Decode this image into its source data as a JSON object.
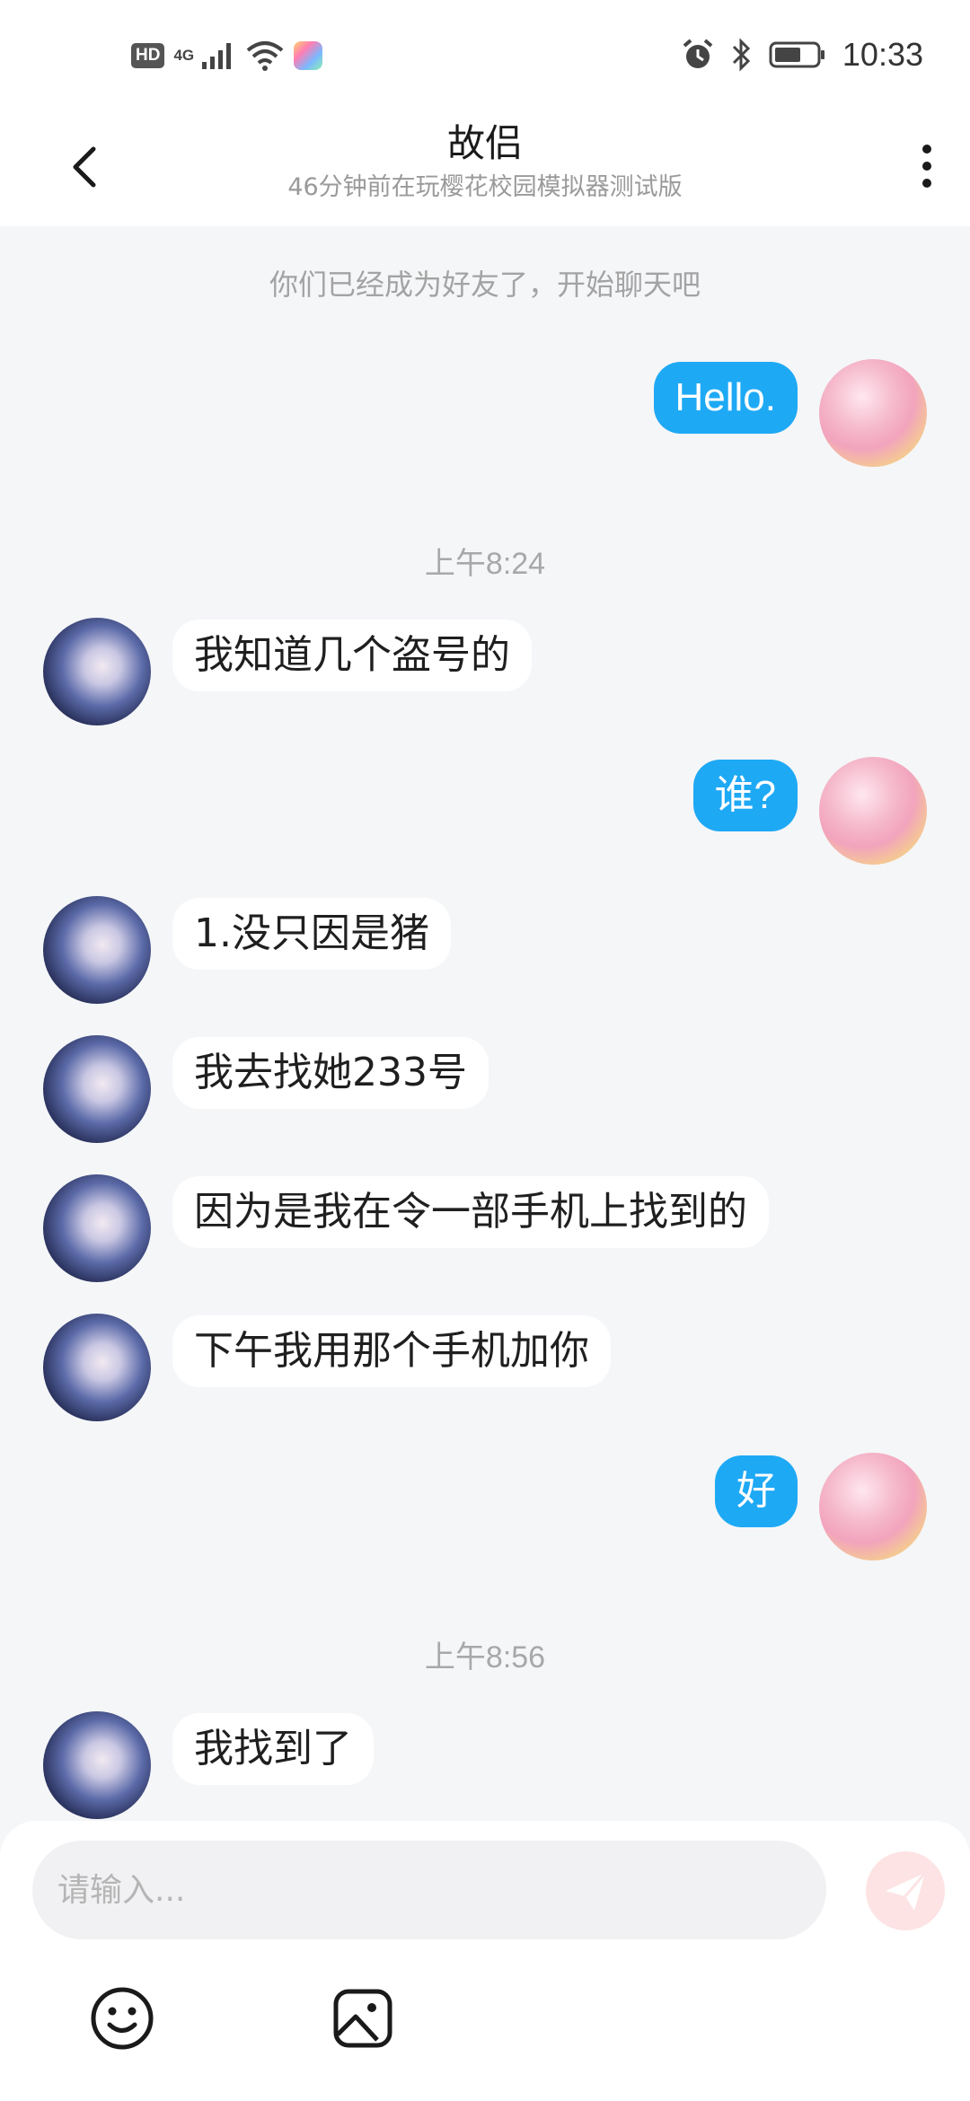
{
  "status_bar": {
    "hd_label": "HD",
    "network_label": "4G",
    "time": "10:33"
  },
  "header": {
    "title": "故侣",
    "subtitle": "46分钟前在玩樱花校园模拟器测试版",
    "back_icon": "chevron-left-icon",
    "more_icon": "more-vertical-icon"
  },
  "chat": {
    "system_note": "你们已经成为好友了，开始聊天吧",
    "time_separators": [
      "上午8:24",
      "上午8:56"
    ],
    "messages": [
      {
        "sender": "me",
        "text": "Hello."
      },
      {
        "sender": "other",
        "text": "我知道几个盗号的"
      },
      {
        "sender": "me",
        "text": "谁?"
      },
      {
        "sender": "other",
        "text": "1.没只因是猪"
      },
      {
        "sender": "other",
        "text": "我去找她233号"
      },
      {
        "sender": "other",
        "text": "因为是我在令一部手机上找到的"
      },
      {
        "sender": "other",
        "text": "下午我用那个手机加你"
      },
      {
        "sender": "me",
        "text": "好"
      },
      {
        "sender": "other",
        "text": "我找到了"
      }
    ]
  },
  "input": {
    "placeholder": "请输入...",
    "value": "",
    "send_icon": "paper-plane-icon",
    "emoji_icon": "smiley-icon",
    "image_icon": "image-icon"
  },
  "colors": {
    "my_bubble": "#1ea9f5",
    "other_bubble": "#ffffff",
    "background": "#f5f6f8",
    "send_button": "#fde3e3"
  }
}
